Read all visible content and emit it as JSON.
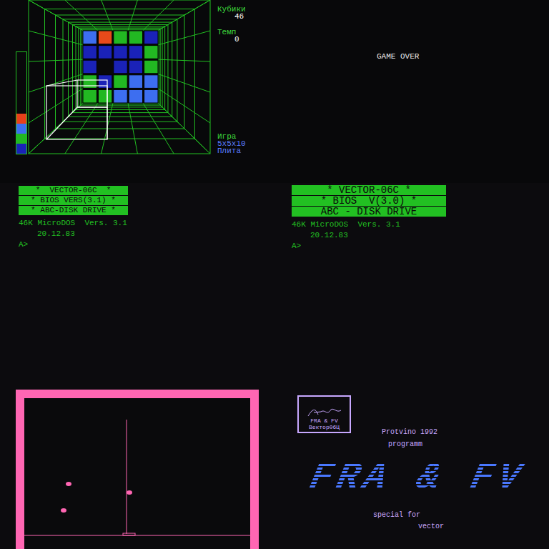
{
  "blockout": {
    "depth_meter": [
      "#e8401a",
      "#3d6ef0",
      "#22b822",
      "#1a22b8"
    ],
    "board": [
      [
        "#3d6ef0",
        "#e84a1a",
        "#22b822",
        "#22b822",
        "#1a22b8"
      ],
      [
        "#1a22b8",
        "#1a22b8",
        "#1a22b8",
        "#1a22b8",
        "#22b822"
      ],
      [
        "#1a22b8",
        null,
        "#1a22b8",
        "#1a22b8",
        "#22b822"
      ],
      [
        "#22b822",
        "#1a22b8",
        "#22b822",
        "#3d6ef0",
        "#3d6ef0"
      ],
      [
        "#22b822",
        "#22b822",
        "#3d6ef0",
        "#3d6ef0",
        "#3d6ef0"
      ]
    ],
    "stats": [
      {
        "label": "Кубики",
        "value": "46"
      },
      {
        "label": "Темп",
        "value": "0"
      }
    ],
    "mode": {
      "label": "Игра",
      "lines": [
        "5x5x10",
        "Плита"
      ]
    }
  },
  "game_over": {
    "text": "GAME OVER"
  },
  "boot_small": {
    "banners": [
      "*  VECTOR-06C  *",
      "* BIOS VERS(3.1) *",
      "* ABC-DISK DRIVE *"
    ],
    "lines": [
      "46K MicroDOS  Vers. 3.1",
      "20.12.83"
    ],
    "prompt": "A>"
  },
  "boot_large": {
    "banners": [
      "* VECTOR-06C *",
      "* BIOS  V(3.0) *",
      "ABC - DISK DRIVE"
    ],
    "lines": [
      "46K MicroDOS  Vers. 3.1",
      "20.12.83"
    ],
    "prompt": "A>"
  },
  "intro": {
    "logo_lines": [
      "FRA & FV",
      "Вектор06Ц"
    ],
    "place": "Protvino 1992",
    "subtitle": "programm",
    "title": "FRA & FV",
    "footer": [
      "special for",
      "vector"
    ]
  }
}
